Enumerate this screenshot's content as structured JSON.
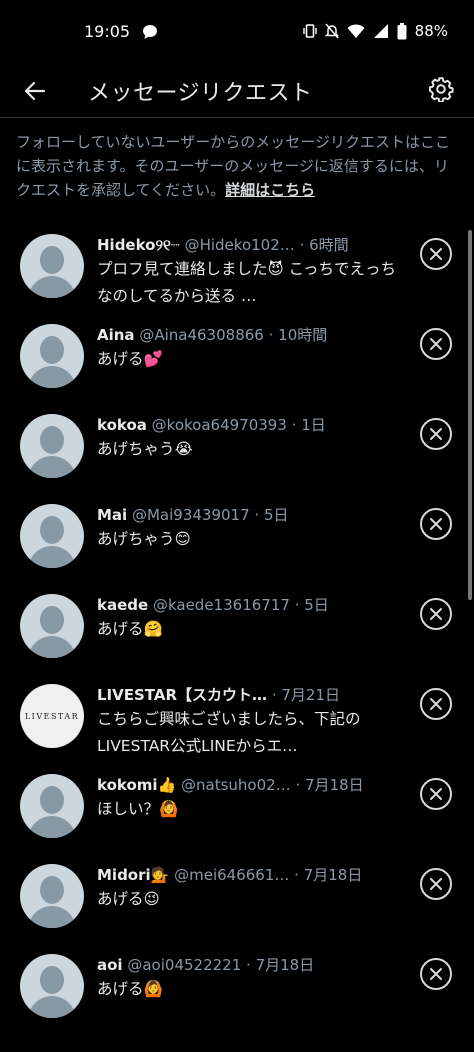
{
  "status": {
    "time": "19:05",
    "battery": "88%"
  },
  "header": {
    "title": "メッセージリクエスト"
  },
  "info": {
    "text": "フォローしていないユーザーからのメッセージリクエストはここに表示されます。そのユーザーのメッセージに返信するには、リクエストを承認してください。",
    "link": "詳細はこちら"
  },
  "requests": [
    {
      "name": "Hideko୨୧┈",
      "handle": "@Hideko102…",
      "time": "· 6時間",
      "message": "プロフ見て連絡しました😈 こっちでえっちなのしてるから送る …"
    },
    {
      "name": "Aina",
      "handle": "@Aina46308866",
      "time": "· 10時間",
      "message": "あげる💕"
    },
    {
      "name": "kokoa",
      "handle": "@kokoa64970393",
      "time": "· 1日",
      "message": "あげちゃう😭"
    },
    {
      "name": "Mai",
      "handle": "@Mai93439017",
      "time": "· 5日",
      "message": "あげちゃう😊"
    },
    {
      "name": "kaede",
      "handle": "@kaede13616717",
      "time": "· 5日",
      "message": "あげる🤗"
    },
    {
      "name": "LIVESTAR【スカウト…",
      "handle": "",
      "time": "· 7月21日",
      "message": "こちらご興味ございましたら、下記のLIVESTAR公式LINEからエ…",
      "avatar_text": "LIVESTAR"
    },
    {
      "name": "kokomi👍",
      "handle": "@natsuho02…",
      "time": "· 7月18日",
      "message": "ほしい？🙆"
    },
    {
      "name": "Midori💁",
      "handle": "@mei646661…",
      "time": "· 7月18日",
      "message": "あげる😉"
    },
    {
      "name": "aoi",
      "handle": "@aoi04522221",
      "time": "· 7月18日",
      "message": "あげる🙆"
    }
  ]
}
